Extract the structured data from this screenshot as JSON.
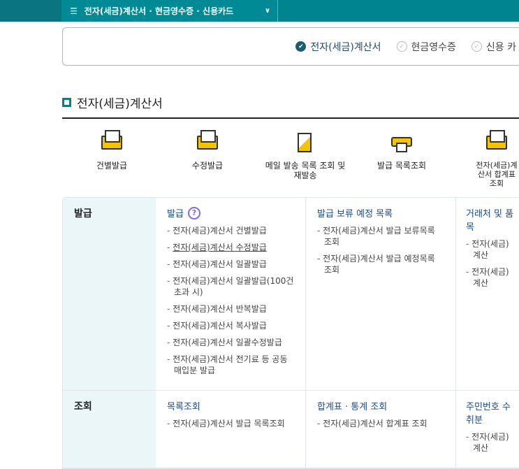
{
  "header": {
    "menu_label": "전자(세금)계산서 · 현금영수증 · 신용카드"
  },
  "tabs": [
    {
      "label": "전자(세금)계산서",
      "active": true
    },
    {
      "label": "현금영수증",
      "active": false
    },
    {
      "label": "신용 카",
      "active": false
    }
  ],
  "section_title": "전자(세금)계산서",
  "quick_links": [
    {
      "label": "건별발급",
      "icon": "envelope-gear-icon"
    },
    {
      "label": "수정발급",
      "icon": "envelope-arrow-icon"
    },
    {
      "label": "메일 발송 목록 조회 및 재발송",
      "icon": "scroll-icon"
    },
    {
      "label": "발급 목록조회",
      "icon": "printer-icon"
    },
    {
      "label": "전자(세금)계산서 합계표 조회",
      "icon": "envelope-plus-icon"
    }
  ],
  "rows": [
    {
      "header": "발급",
      "columns": [
        {
          "title": "발급",
          "help": "?",
          "items": [
            "전자(세금)계산서 건별발급",
            "전자(세금)계산서 수정발급",
            "전자(세금)계산서 일괄발급",
            "전자(세금)계산서 일괄발급(100건 초과 시)",
            "전자(세금)계산서 반복발급",
            "전자(세금)계산서 복사발급",
            "전자(세금)계산서 일괄수정발급",
            "전자(세금)계산서 전기료 등 공동매입분 발급"
          ]
        },
        {
          "title": "발급 보류 예정 목록",
          "items": [
            "전자(세금)계산서 발급 보류목록 조회",
            "전자(세금)계산서 발급 예정목록 조회"
          ]
        },
        {
          "title": "거래처 및 품목",
          "items": [
            "전자(세금)계산",
            "전자(세금)계산"
          ]
        }
      ]
    },
    {
      "header": "조회",
      "columns": [
        {
          "title": "목록조회",
          "items": [
            "전자(세금)계산서 발급 목록조회"
          ]
        },
        {
          "title": "합계표 · 통계 조회",
          "items": [
            "전자(세금)계산서 합계표 조회"
          ]
        },
        {
          "title": "주민번호 수취분",
          "items": [
            "전자(세금)계산"
          ]
        }
      ]
    }
  ]
}
